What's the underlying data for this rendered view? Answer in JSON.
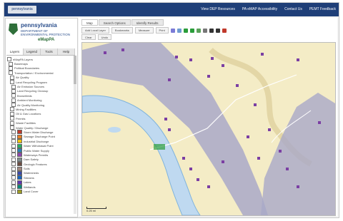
{
  "header": {
    "logo_text": "pennsylvania",
    "links": [
      "View DEP Resources",
      "PA eMAP Accessibility",
      "Contact Us",
      "PEMT Feedback"
    ]
  },
  "sidebar": {
    "brand_name": "pennsylvania",
    "brand_dept": "DEPARTMENT OF ENVIRONMENTAL PROTECTION",
    "brand_app": "eMapPA",
    "tabs": [
      "Layers",
      "Legend",
      "Tools",
      "Help"
    ],
    "active_tab": 0,
    "tree": [
      {
        "label": "eMapPA Layers",
        "swatch": ""
      },
      {
        "label": "Basemaps",
        "swatch": ""
      },
      {
        "label": "Political Boundaries",
        "swatch": ""
      },
      {
        "label": "Transportation / Environmental",
        "swatch": ""
      },
      {
        "label": "Air Quality",
        "swatch": ""
      },
      {
        "label": "Land Recycling Program",
        "swatch": ""
      },
      {
        "label": "Air Emission Sources",
        "swatch": ""
      },
      {
        "label": "Land Recycling Cleanup",
        "swatch": ""
      },
      {
        "label": "Brownfields",
        "swatch": ""
      },
      {
        "label": "Ambient Monitoring",
        "swatch": ""
      },
      {
        "label": "Air Quality Monitoring",
        "swatch": ""
      },
      {
        "label": "Mining Facilities",
        "swatch": ""
      },
      {
        "label": "Oil & Gas Locations",
        "swatch": ""
      },
      {
        "label": "Permits",
        "swatch": ""
      },
      {
        "label": "Waste Facilities",
        "swatch": ""
      },
      {
        "label": "Water Quality / Discharge",
        "swatch": ""
      },
      {
        "label": "Storm Water Discharge",
        "swatch": "#c0392b"
      },
      {
        "label": "Sewage Discharge Point",
        "swatch": "#e67e22"
      },
      {
        "label": "Industrial Discharge",
        "swatch": "#f1c40f"
      },
      {
        "label": "Water Withdrawal Point",
        "swatch": "#27ae60"
      },
      {
        "label": "Public Water Supply",
        "swatch": "#2980b9"
      },
      {
        "label": "Waterways Permits",
        "swatch": "#8e44ad"
      },
      {
        "label": "Dam Safety",
        "swatch": "#7f8c8d"
      },
      {
        "label": "Geologic Features",
        "swatch": "#6d4c41"
      },
      {
        "label": "Soils",
        "swatch": "#a1887f"
      },
      {
        "label": "Watersheds",
        "swatch": "#3949ab"
      },
      {
        "label": "Streams",
        "swatch": "#1565c0"
      },
      {
        "label": "Lakes",
        "swatch": "#5e35b1"
      },
      {
        "label": "Wetlands",
        "swatch": "#00897b"
      },
      {
        "label": "Land Cover",
        "swatch": "#9e9d24"
      }
    ]
  },
  "main": {
    "tabs": [
      "Map",
      "Search Options",
      "Identify Results"
    ],
    "active_tab": 0,
    "toolbar_buttons": [
      "Add Local Layer",
      "Bookmarks",
      "Measure",
      "Print"
    ],
    "tool_icons": [
      "#7b7bd6",
      "#6f9bd1",
      "#2a9d3a",
      "#2a9d3a",
      "#5aa15a",
      "#777777",
      "#333333",
      "#333333",
      "#c0392b"
    ],
    "toolbar2_buttons": [
      "Clear",
      "Undo"
    ],
    "scale_label": "0.25 mi"
  },
  "colors": {
    "header": "#1f3f78",
    "map_base": "#f4ecc6",
    "river": "#bfd9f0",
    "river_edge": "#7fb3dd",
    "overlay": "#a9a9c8",
    "marker": "#7b3fa3",
    "road": "#ffffff"
  }
}
